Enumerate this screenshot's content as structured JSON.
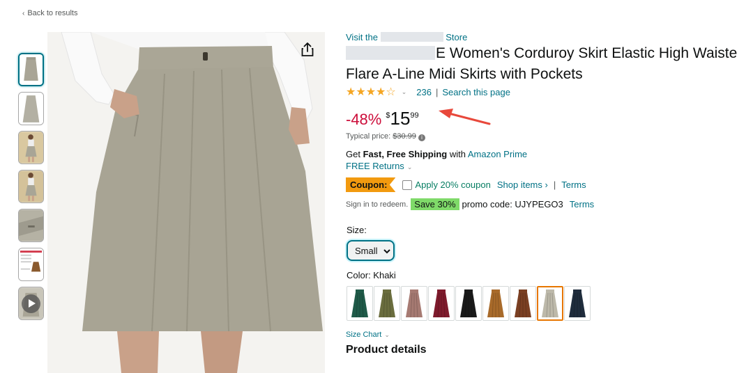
{
  "nav": {
    "back_label": "Back to results"
  },
  "product": {
    "visit_prefix": "Visit the",
    "visit_suffix": "Store",
    "title_line1": "E Women's Corduroy Skirt Elastic High Waiste",
    "title_line2": "Flare A-Line Midi Skirts with Pockets",
    "rating_stars": 4,
    "rating_count": "236",
    "search_page": "Search this page",
    "discount": "-48%",
    "currency": "$",
    "price_whole": "15",
    "price_fraction": "99",
    "typical_label": "Typical price:",
    "typical_price": "$30.99",
    "shipping_get": "Get",
    "shipping_bold": "Fast, Free Shipping",
    "shipping_with": "with",
    "shipping_link": "Amazon Prime",
    "returns": "FREE Returns",
    "coupon_tag": "Coupon:",
    "coupon_text": "Apply 20% coupon",
    "shop_items": "Shop items ›",
    "terms": "Terms",
    "signin": "Sign in to redeem.",
    "save_badge": "Save 30%",
    "promo_code": "promo code: UJYPEGO3",
    "promo_terms": "Terms",
    "size_label": "Size:",
    "size_value": "Small",
    "color_label": "Color: Khaki",
    "size_chart": "Size Chart",
    "product_details": "Product details"
  },
  "colors": {
    "link": "#007185",
    "discount": "#CC0C39",
    "coupon": "#F29A0F",
    "save_badge": "#7FDA69",
    "stars": "#F5A623",
    "arrow": "#E8483B"
  },
  "swatches": [
    {
      "name": "green",
      "color": "#1f5a48"
    },
    {
      "name": "olive",
      "color": "#6a6d3e"
    },
    {
      "name": "mauve",
      "color": "#a67a72"
    },
    {
      "name": "burgundy",
      "color": "#7e1a2c"
    },
    {
      "name": "black",
      "color": "#1a1a1a"
    },
    {
      "name": "caramel",
      "color": "#a86a2a"
    },
    {
      "name": "brown",
      "color": "#7a3f22"
    },
    {
      "name": "khaki",
      "color": "#bdb9aa",
      "selected": true
    },
    {
      "name": "navy",
      "color": "#1f2c3c"
    }
  ],
  "thumbnails": [
    {
      "name": "thumb-1-front",
      "selected": true
    },
    {
      "name": "thumb-2-flat"
    },
    {
      "name": "thumb-3-model"
    },
    {
      "name": "thumb-4-model"
    },
    {
      "name": "thumb-5-detail"
    },
    {
      "name": "thumb-6-size-chart"
    },
    {
      "name": "thumb-7-video"
    }
  ],
  "icons": {
    "share": "share-icon",
    "video": "play-icon",
    "arrow": "red-arrow-annotation"
  }
}
